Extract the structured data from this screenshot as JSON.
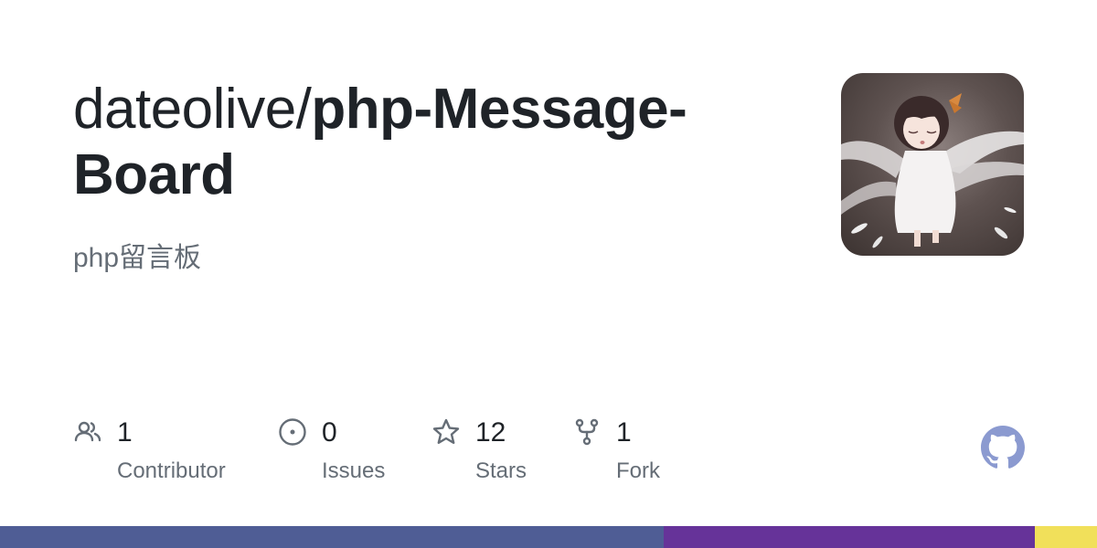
{
  "repo": {
    "owner": "dateolive/",
    "name": "php-Message-Board",
    "description": "php留言板"
  },
  "stats": [
    {
      "icon": "contributors-icon",
      "count": "1",
      "label": "Contributor"
    },
    {
      "icon": "issues-icon",
      "count": "0",
      "label": "Issues"
    },
    {
      "icon": "star-icon",
      "count": "12",
      "label": "Stars"
    },
    {
      "icon": "fork-icon",
      "count": "1",
      "label": "Fork"
    }
  ],
  "colors": {
    "icon": "#656d76",
    "github_logo": "#8b9ad0",
    "language_bar": [
      "#4f5d95",
      "#663399",
      "#f1e05a"
    ]
  },
  "languages": [
    {
      "color": "#4f5d95",
      "share": 0.605
    },
    {
      "color": "#663399",
      "share": 0.338
    },
    {
      "color": "#f1e05a",
      "share": 0.057
    }
  ]
}
